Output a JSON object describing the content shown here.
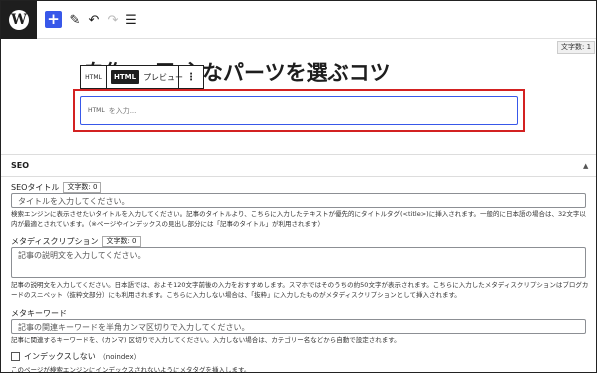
{
  "toolbar": {
    "logo": "W",
    "add_icon": "+",
    "edit_icon": "✎",
    "undo_icon": "↶",
    "redo_icon": "↷",
    "list_icon": "☰"
  },
  "editor": {
    "char_count": "文字数: 1",
    "post_title": "自作PC用 主なパーツを選ぶコツ",
    "block_toolbar": {
      "html_label": "HTML",
      "html_tab": "HTML",
      "preview_tab": "プレビュー",
      "more_icon": "⋮"
    },
    "html_block": {
      "tag": "HTML",
      "placeholder": "を入力..."
    }
  },
  "seo": {
    "title": "SEO",
    "caret": "▲",
    "seo_title": {
      "label": "SEOタイトル",
      "count": "文字数: 0",
      "placeholder": "タイトルを入力してください。",
      "help": "検索エンジンに表示させたいタイトルを入力してください。記事のタイトルより、こちらに入力したテキストが優先的にタイトルタグ(<title>)に挿入されます。一般的に日本語の場合は、32文字以内が最適とされています。（※ページやインデックスの見出し部分には「記事のタイトル」が利用されます）"
    },
    "meta_description": {
      "label": "メタディスクリプション",
      "count": "文字数: 0",
      "placeholder": "記事の説明文を入力してください。",
      "help": "記事の説明文を入力してください。日本語では、およそ120文字前後の入力をおすすめします。スマホではそのうちの約50文字が表示されます。こちらに入力したメタディスクリプションはブログカードのスニペット（抜粋文部分）にも利用されます。こちらに入力しない場合は、「抜粋」に入力したものがメタディスクリプションとして挿入されます。"
    },
    "meta_keywords": {
      "label": "メタキーワード",
      "placeholder": "記事の関連キーワードを半角カンマ区切りで入力してください。",
      "help": "記事に関連するキーワードを、(カンマ) 区切りで入力してください。入力しない場合は、カテゴリー名などから自動で設定されます。"
    },
    "noindex": {
      "label": "インデックスしない",
      "sub": "（noindex）",
      "help": "このページが検索エンジンにインデックスされないようにメタタグを挿入します。"
    }
  }
}
